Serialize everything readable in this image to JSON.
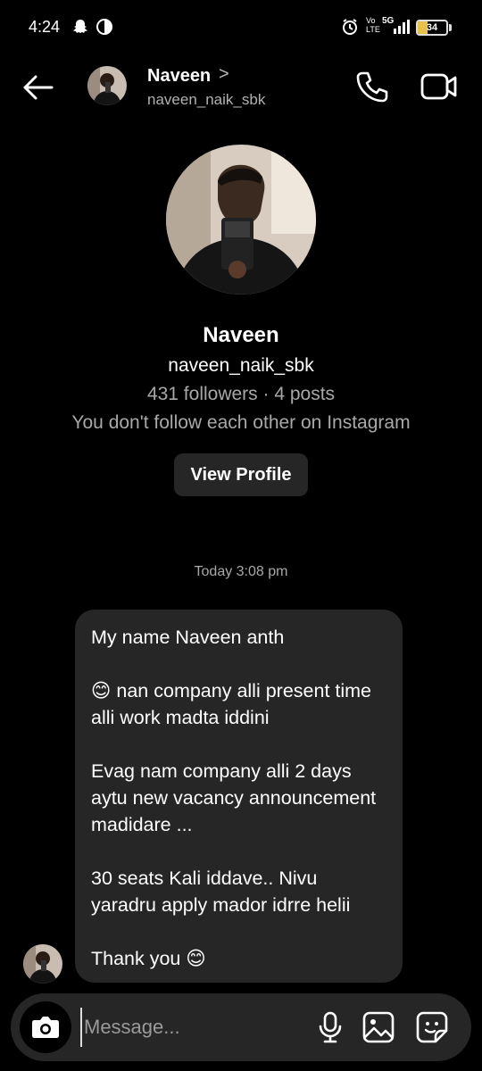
{
  "status_bar": {
    "time": "4:24",
    "network_top": "Vo",
    "network_bottom": "LTE",
    "network_type": "5G",
    "battery": "34"
  },
  "header": {
    "name": "Naveen",
    "chevron": ">",
    "username": "naveen_naik_sbk"
  },
  "profile": {
    "name": "Naveen",
    "username": "naveen_naik_sbk",
    "stats": "431 followers · 4 posts",
    "follow_status": "You don't follow each other on Instagram",
    "view_profile_label": "View Profile"
  },
  "chat": {
    "timestamp": "Today 3:08 pm",
    "message": {
      "line1": "My name Naveen anth",
      "line2": "😊 nan company alli present time alli work madta iddini",
      "line3": "Evag nam company alli 2 days aytu new vacancy announcement madidare ...",
      "line4": "30 seats Kali iddave.. Nivu yaradru apply mador idrre helii",
      "line5": "Thank you 😊"
    }
  },
  "composer": {
    "placeholder": "Message..."
  },
  "icons": {
    "back": "arrow-left-icon",
    "call": "phone-icon",
    "video": "video-camera-icon",
    "camera": "camera-icon",
    "mic": "microphone-icon",
    "gallery": "image-icon",
    "sticker": "sticker-icon"
  },
  "colors": {
    "background": "#000000",
    "bubble": "#262626",
    "secondary_text": "#a8a8a8"
  }
}
